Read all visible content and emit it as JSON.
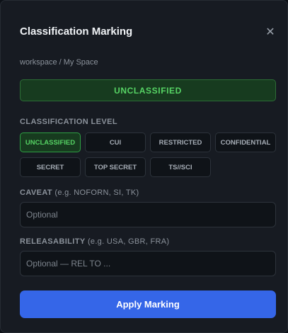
{
  "dialog": {
    "title": "Classification Marking",
    "close_icon": "close-icon",
    "close_glyph": "✕",
    "breadcrumb": "workspace / My Space"
  },
  "banner": {
    "text": "UNCLASSIFIED",
    "color": "#56d364"
  },
  "classification_level": {
    "label": "CLASSIFICATION LEVEL",
    "selected": "UNCLASSIFIED",
    "options": [
      "UNCLASSIFIED",
      "CUI",
      "RESTRICTED",
      "CONFIDENTIAL",
      "SECRET",
      "TOP SECRET",
      "TS//SCI"
    ]
  },
  "caveat": {
    "label": "CAVEAT",
    "hint": " (e.g. NOFORN, SI, TK)",
    "placeholder": "Optional",
    "value": ""
  },
  "releasability": {
    "label": "RELEASABILITY",
    "hint": " (e.g. USA, GBR, FRA)",
    "placeholder": "Optional — REL TO ...",
    "value": ""
  },
  "apply_button": {
    "label": "Apply Marking",
    "color": "#3566e8"
  }
}
